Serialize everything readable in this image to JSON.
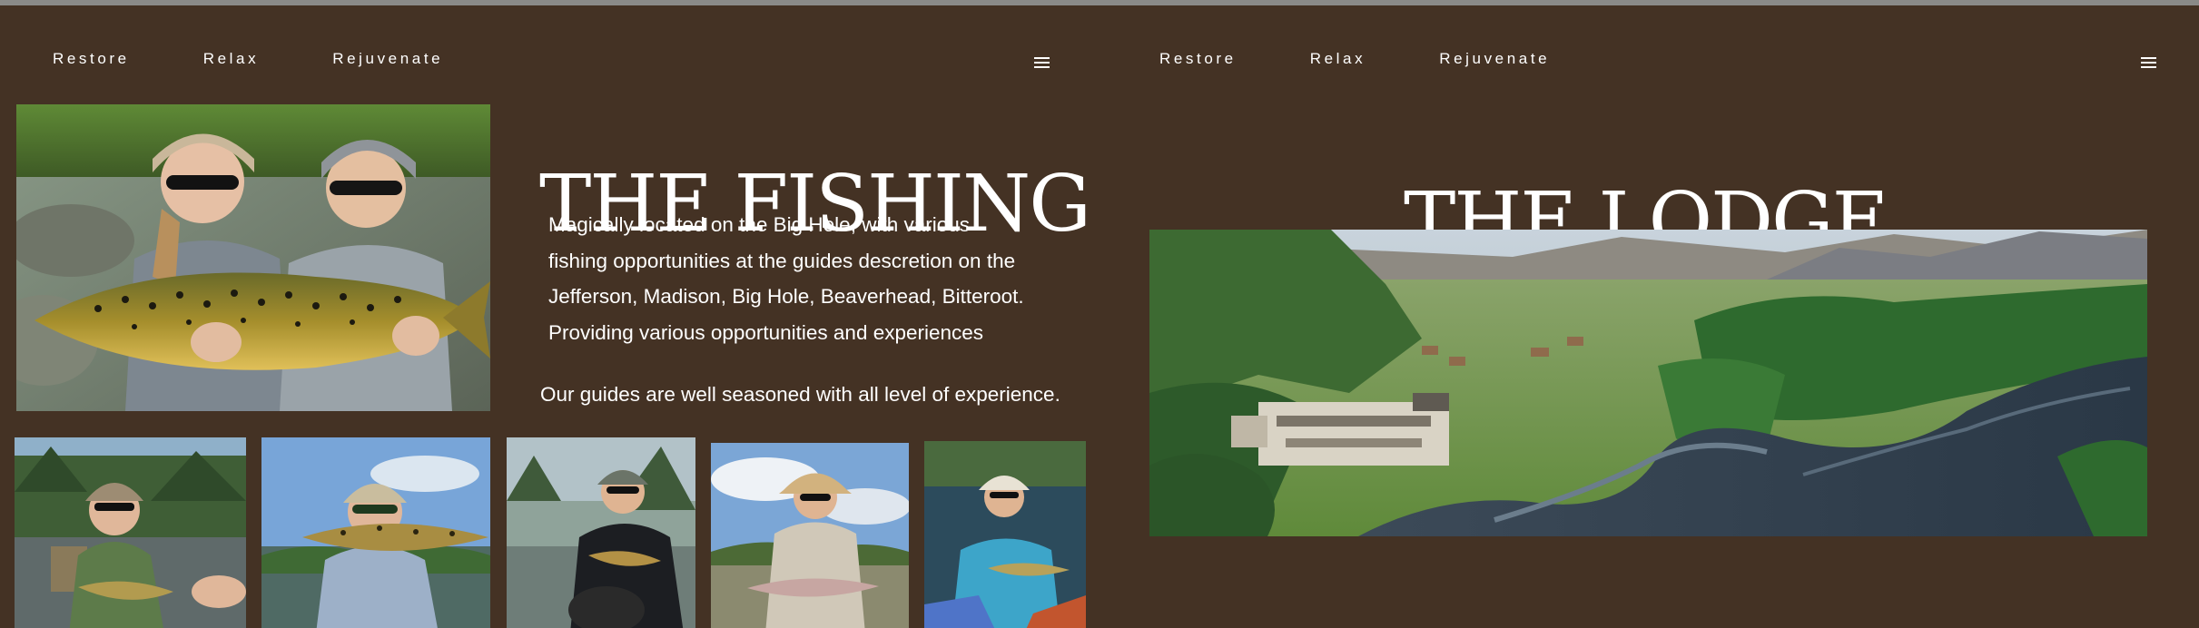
{
  "fishing": {
    "nav": {
      "restore": "Restore",
      "relax": "Relax",
      "rejuvenate": "Rejuvenate"
    },
    "title": "THE FISHING",
    "description": [
      "Magically located on the Big Hole, with various",
      "fishing opportunities at the guides descretion on the",
      "Jefferson, Madison, Big Hole, Beaverhead, Bitteroot.",
      "Providing various opportunities and experiences"
    ],
    "guides_text": "Our guides are well seasoned with all level of experience."
  },
  "lodge": {
    "nav": {
      "restore": "Restore",
      "relax": "Relax",
      "rejuvenate": "Rejuvenate"
    },
    "title": "THE LODGE"
  },
  "colors": {
    "background": "#443224",
    "text": "#ffffff",
    "top_strip": "#8a8a88",
    "selection_outline": "#9d6cf5"
  },
  "icons": {
    "menu": "hamburger-menu-icon"
  }
}
